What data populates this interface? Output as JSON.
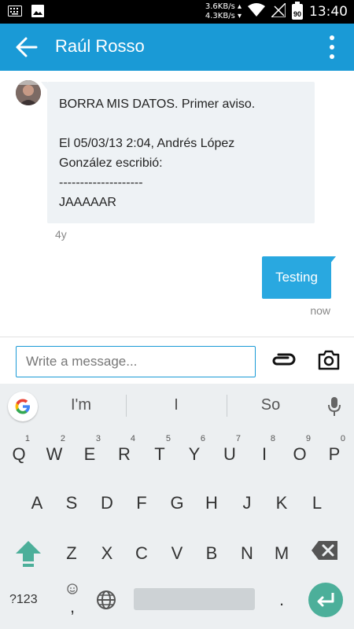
{
  "status_bar": {
    "net_up": "3.6KB/s",
    "net_down": "4.3KB/s",
    "battery": "90",
    "time": "13:40"
  },
  "app_bar": {
    "title": "Raúl Rosso",
    "color": "#1a9ad6"
  },
  "messages": {
    "incoming": {
      "lines": [
        "BORRA MIS DATOS. Primer aviso.",
        "",
        "El 05/03/13 2:04, Andrés López",
        "González escribió:",
        "--------------------",
        "JAAAAAR"
      ],
      "time": "4y"
    },
    "outgoing": {
      "text": "Testing",
      "time": "now",
      "color": "#29a8e0"
    }
  },
  "composer": {
    "placeholder": "Write a message..."
  },
  "keyboard": {
    "suggestions": [
      "I'm",
      "I",
      "So"
    ],
    "row1": [
      {
        "label": "Q",
        "hint": "1"
      },
      {
        "label": "W",
        "hint": "2"
      },
      {
        "label": "E",
        "hint": "3"
      },
      {
        "label": "R",
        "hint": "4"
      },
      {
        "label": "T",
        "hint": "5"
      },
      {
        "label": "Y",
        "hint": "6"
      },
      {
        "label": "U",
        "hint": "7"
      },
      {
        "label": "I",
        "hint": "8"
      },
      {
        "label": "O",
        "hint": "9"
      },
      {
        "label": "P",
        "hint": "0"
      }
    ],
    "row2": [
      "A",
      "S",
      "D",
      "F",
      "G",
      "H",
      "J",
      "K",
      "L"
    ],
    "row3": [
      "Z",
      "X",
      "C",
      "V",
      "B",
      "N",
      "M"
    ],
    "symbols_label": "?123",
    "comma": ",",
    "period": ".",
    "enter_color": "#4caf9a"
  }
}
